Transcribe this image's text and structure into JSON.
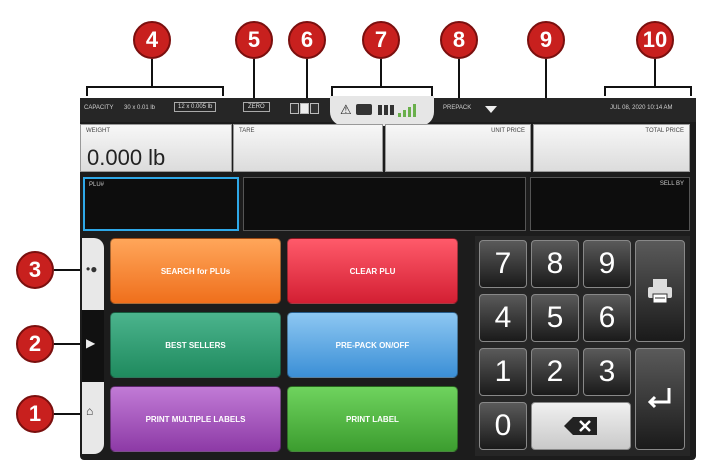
{
  "callouts": {
    "c1": "1",
    "c2": "2",
    "c3": "3",
    "c4": "4",
    "c5": "5",
    "c6": "6",
    "c7": "7",
    "c8": "8",
    "c9": "9",
    "c10": "10"
  },
  "topbar": {
    "capacity_label": "CAPACITY",
    "capacity_value": "30 x 0.01 lb",
    "capacity_secondary": "12 x 0.005 lb",
    "zero_label": "ZERO",
    "prepack_label": "PREPACK",
    "datetime": "JUL 08, 2020 10:14 AM"
  },
  "display": {
    "weight_label": "WEIGHT",
    "weight_value": "0.000 lb",
    "tare_label": "TARE",
    "unit_price_label": "UNIT PRICE",
    "total_price_label": "TOTAL PRICE"
  },
  "plu_row": {
    "plu_label": "PLU#",
    "sell_by_label": "SELL BY"
  },
  "buttons": {
    "search_plus": "SEARCH for PLUs",
    "clear_plu": "CLEAR PLU",
    "best_sellers": "BEST SELLERS",
    "prepack_toggle": "PRE-PACK ON/OFF",
    "print_multiple": "PRINT MULTIPLE LABELS",
    "print_label": "PRINT LABEL"
  },
  "keypad": {
    "k7": "7",
    "k8": "8",
    "k9": "9",
    "k4": "4",
    "k5": "5",
    "k6": "6",
    "k1": "1",
    "k2": "2",
    "k3": "3",
    "k0": "0"
  },
  "icons": {
    "warning": "warning-icon",
    "printer": "printer-icon",
    "grid": "grid-icon",
    "signal": "signal-icon",
    "backspace": "backspace-icon",
    "enter": "enter-icon",
    "home": "home-icon"
  }
}
